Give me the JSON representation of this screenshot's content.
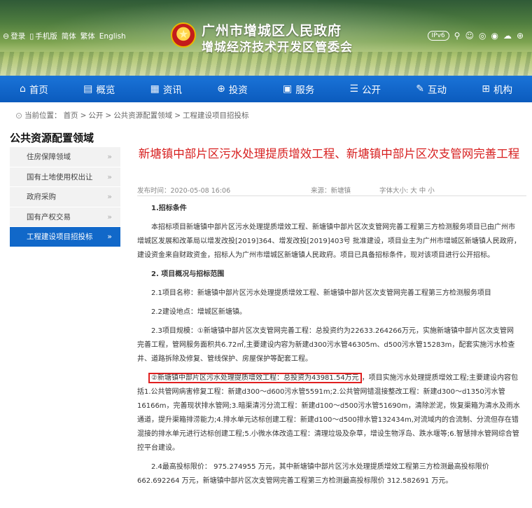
{
  "header": {
    "top_links": [
      {
        "icon": "user-icon",
        "label": "登录"
      },
      {
        "icon": "mobile-icon",
        "label": "手机版"
      },
      {
        "label": "简体"
      },
      {
        "label": "繁体"
      },
      {
        "label": "English"
      }
    ],
    "title_line1": "广州市增城区人民政府",
    "title_line2": "增城经济技术开发区管委会",
    "right_icons": {
      "ipv6": "IPv6",
      "icons": [
        "search-icon",
        "accessibility-icon",
        "elder-care-icon",
        "weibo-icon",
        "wechat-icon",
        "app-icon"
      ]
    }
  },
  "nav": {
    "items": [
      {
        "icon": "home-icon",
        "label": "首页"
      },
      {
        "icon": "overview-icon",
        "label": "概览"
      },
      {
        "icon": "news-icon",
        "label": "资讯"
      },
      {
        "icon": "investment-icon",
        "label": "投资"
      },
      {
        "icon": "service-icon",
        "label": "服务"
      },
      {
        "icon": "public-icon",
        "label": "公开"
      },
      {
        "icon": "interaction-icon",
        "label": "互动"
      },
      {
        "icon": "institution-icon",
        "label": "机构"
      }
    ]
  },
  "breadcrumb": {
    "prefix": "当前位置：",
    "items": [
      "首页",
      "公开",
      "公共资源配置领域",
      "工程建设项目招投标"
    ],
    "separator": ">"
  },
  "sidebar": {
    "title": "公共资源配置领域",
    "items": [
      {
        "label": "住房保障领域",
        "active": false
      },
      {
        "label": "国有土地使用权出让",
        "active": false
      },
      {
        "label": "政府采购",
        "active": false
      },
      {
        "label": "国有产权交易",
        "active": false
      },
      {
        "label": "工程建设项目招投标",
        "active": true
      }
    ],
    "arrow": "»"
  },
  "article": {
    "title": "新塘镇中部片区污水处理提质增效工程、新塘镇中部片区次支管网完善工程",
    "date": "发布时间：2020-05-08 16:06",
    "source": "来源：新塘镇",
    "font_size": "字体大小: 大 中 小",
    "paragraphs": [
      {
        "heading": true,
        "text": "1.招标条件"
      },
      {
        "text": "本招标项目新塘镇中部片区污水处理提质增效工程、新塘镇中部片区次支管网完善工程第三方检测服务项目已由广州市增城区发展和改革局以增发改投[2019]364、增发改投[2019]403号 批准建设，项目业主为广州市增城区新塘镇人民政府，建设资金来自财政资金，招标人为广州市增城区新塘镇人民政府。项目已具备招标条件，现对该项目进行公开招标。"
      },
      {
        "heading": true,
        "text": "2. 项目概况与招标范围"
      },
      {
        "text": "2.1项目名称：新塘镇中部片区污水处理提质增效工程、新塘镇中部片区次支管网完善工程第三方检测服务项目"
      },
      {
        "text": "2.2建设地点：增城区新塘镇。"
      },
      {
        "text": "2.3项目规模：①新塘镇中部片区次支管网完善工程：总投资约为22633.264266万元，实施新塘镇中部片区次支管网完善工程，管网服务面积共6.72㎡,主要建设内容为新建d300污水管46305m、d500污水管15283m，配套实施污水检查井、道路拆除及修复、管线保护、房屋保护等配套工程。"
      },
      {
        "highlight": "②新塘镇中部片区污水处理提质增效工程：总投资为43981.54万元",
        "text": "，项目实施污水处理提质增效工程;主要建设内容包括1.公共管网病害修复工程：新建d300～d600污水管5591m;2.公共管网错混接整改工程：新建d300～d1350污水管16166m，完善现状排水管网;3.暗渠清污分流工程：新建d100～d500污水管51690m，清除淤泥，恢复渠箱为清水及雨水通道，提升渠箱排涝能力;4.排水单元达标创建工程：新建d100～d500排水管132434m,对流域内的合流制、分流但存在错混接的排水单元进行达标创建工程;5.小微水体改造工程：清理垃圾及杂草，增设生物浮岛、跌水堰等;6.智慧排水管网综合管控平台建设。"
      },
      {
        "text": "2.4最高投标限价： 975.274955 万元，其中新塘镇中部片区污水处理提质增效工程第三方检测最高投标限价662.692264 万元，新塘镇中部片区次支管网完善工程第三方检测最高投标限价 312.582691 万元。"
      }
    ]
  }
}
